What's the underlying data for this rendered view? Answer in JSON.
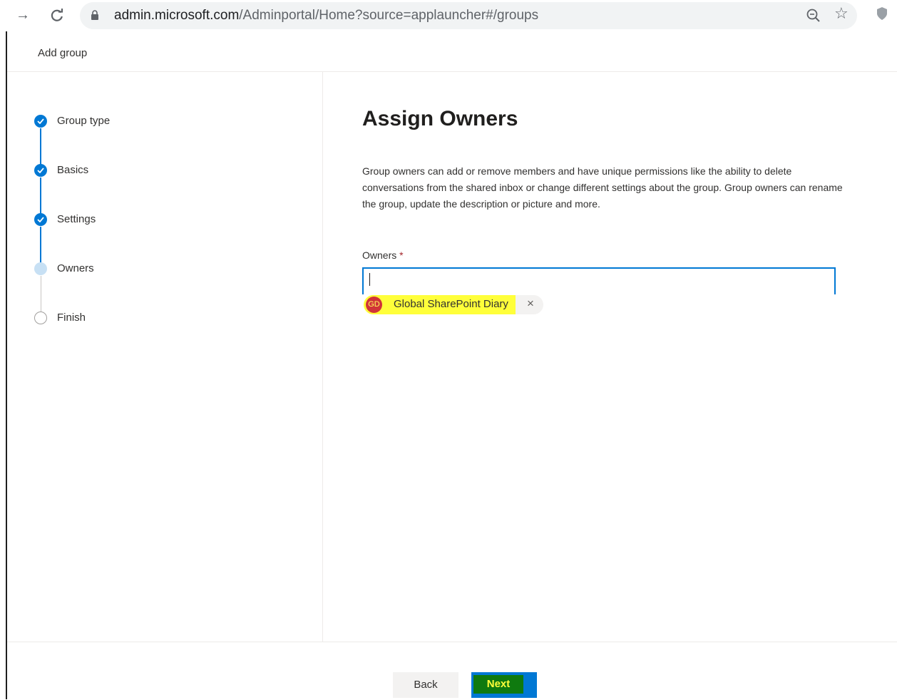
{
  "browser": {
    "url_host": "admin.microsoft.com",
    "url_path": "/Adminportal/Home?source=applauncher#/groups"
  },
  "panel": {
    "title": "Add group"
  },
  "stepper": {
    "steps": [
      {
        "label": "Group type",
        "state": "done"
      },
      {
        "label": "Basics",
        "state": "done"
      },
      {
        "label": "Settings",
        "state": "done"
      },
      {
        "label": "Owners",
        "state": "current"
      },
      {
        "label": "Finish",
        "state": "todo"
      }
    ]
  },
  "main": {
    "title": "Assign Owners",
    "description": "Group owners can add or remove members and have unique permissions like the ability to delete conversations from the shared inbox or change different settings about the group. Group owners can rename the group, update the description or picture and more.",
    "owners_label": "Owners",
    "required_marker": "*",
    "owners_input_value": "",
    "selected_owner": {
      "initials": "GD",
      "name": "Global SharePoint Diary",
      "remove_glyph": "×"
    }
  },
  "footer": {
    "back_label": "Back",
    "next_label": "Next"
  },
  "colors": {
    "accent": "#0078d4",
    "highlight": "#ffff3a",
    "next_highlight": "#0f7a0f",
    "avatar": "#d13438"
  },
  "icons": [
    "forward-icon",
    "reload-icon",
    "lock-icon",
    "zoom-icon",
    "star-icon",
    "extension-icon",
    "check-icon",
    "close-icon"
  ]
}
